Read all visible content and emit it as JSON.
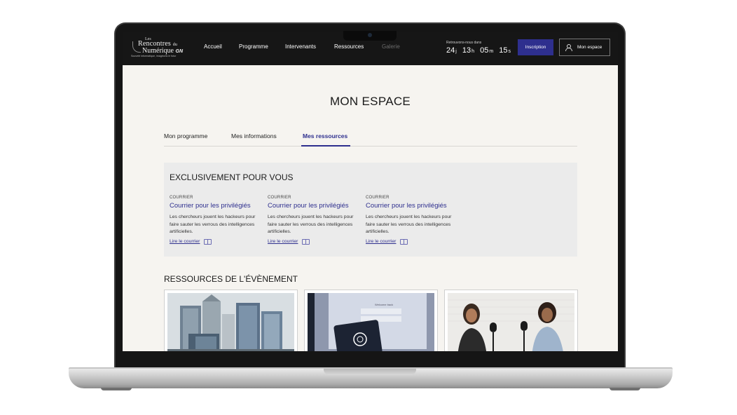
{
  "nav": {
    "logo_line1": "Les",
    "logo_line2": "Rencontres",
    "logo_line2_suffix": "du",
    "logo_line3": "Numérique",
    "logo_brand": "GN",
    "logo_tagline": "Souveté informatique, imaginons le futur",
    "links": [
      "Accueil",
      "Programme",
      "Intervenants",
      "Ressources",
      "Galerie"
    ],
    "countdown_label": "Retrouvons-nous dans",
    "countdown": [
      {
        "value": "24",
        "unit": "j"
      },
      {
        "value": "13",
        "unit": "h"
      },
      {
        "value": "05",
        "unit": "m"
      },
      {
        "value": "15",
        "unit": "s"
      }
    ],
    "inscription_label": "Inscription",
    "espace_label": "Mon espace"
  },
  "page": {
    "title": "MON ESPACE",
    "tabs": [
      "Mon programme",
      "Mes informations",
      "Mes ressources"
    ],
    "active_tab": "Mes ressources"
  },
  "exclusive": {
    "title": "EXCLUSIVEMENT POUR VOUS",
    "cards": [
      {
        "kicker": "COURRIER",
        "title": "Courrier pour les privilégiés",
        "description": "Les chercheurs jouent les hackeurs pour faire sauter les verrous des intelligences artificielles.",
        "link": "Lire le courrier"
      },
      {
        "kicker": "COURRIER",
        "title": "Courrier pour les privilégiés",
        "description": "Les chercheurs jouent les hackeurs pour faire sauter les verrous des intelligences artificielles.",
        "link": "Lire le courrier"
      },
      {
        "kicker": "COURRIER",
        "title": "Courrier pour les privilégiés",
        "description": "Les chercheurs jouent les hackeurs pour faire sauter les verrous des intelligences artificielles.",
        "link": "Lire le courrier"
      }
    ]
  },
  "resources": {
    "title": "RESSOURCES DE L'ÉVÈNEMENT",
    "tablet_text": "Welcome back"
  },
  "colors": {
    "accent": "#2e2f8e",
    "navbar": "#161616",
    "page_bg": "#f6f4f0",
    "panel_bg": "#ebebeb"
  }
}
